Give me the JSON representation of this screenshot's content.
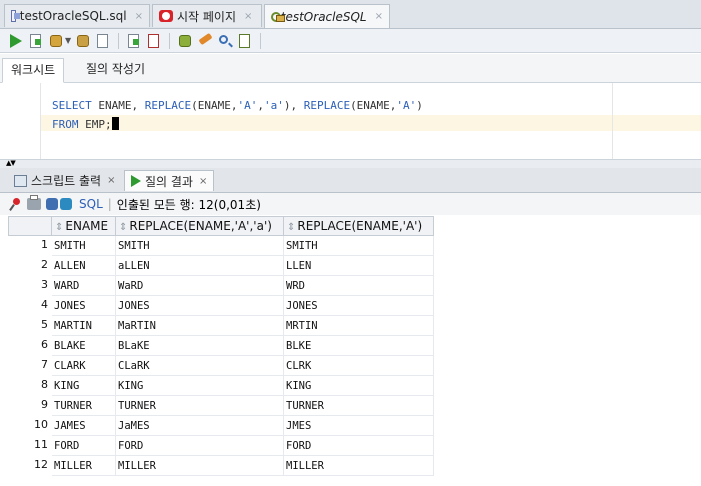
{
  "doc_tabs": [
    {
      "label": "testOracleSQL.sql",
      "icon": "sql-file-icon",
      "close": "×"
    },
    {
      "label": "시작 페이지",
      "icon": "start-page-icon",
      "close": "×"
    },
    {
      "label": "testOracleSQL",
      "icon": "db-connection-icon",
      "close": "×"
    }
  ],
  "subtabs": {
    "worksheet": "워크시트",
    "query_builder": "질의 작성기"
  },
  "editor": {
    "line1": [
      {
        "t": "SELECT",
        "c": "kw"
      },
      {
        "t": " ENAME, ",
        "c": "plain"
      },
      {
        "t": "REPLACE",
        "c": "kw"
      },
      {
        "t": "(ENAME,",
        "c": "plain"
      },
      {
        "t": "'A'",
        "c": "str"
      },
      {
        "t": ",",
        "c": "plain"
      },
      {
        "t": "'a'",
        "c": "str"
      },
      {
        "t": "), ",
        "c": "plain"
      },
      {
        "t": "REPLACE",
        "c": "kw"
      },
      {
        "t": "(ENAME,",
        "c": "plain"
      },
      {
        "t": "'A'",
        "c": "str"
      },
      {
        "t": ")",
        "c": "plain"
      }
    ],
    "line2": [
      {
        "t": "FROM",
        "c": "kw"
      },
      {
        "t": " EMP;",
        "c": "plain"
      }
    ]
  },
  "output_tabs": [
    {
      "label": "스크립트 출력",
      "close": "×"
    },
    {
      "label": "질의 결과",
      "close": "×"
    }
  ],
  "results_toolbar": {
    "sql_label": "SQL",
    "separator": "|",
    "status": "인출된 모든 행: 12(0,01초)"
  },
  "grid": {
    "columns": [
      "ENAME",
      "REPLACE(ENAME,'A','a')",
      "REPLACE(ENAME,'A')"
    ],
    "rows": [
      {
        "n": "1",
        "cells": [
          "SMITH",
          "SMITH",
          "SMITH"
        ]
      },
      {
        "n": "2",
        "cells": [
          "ALLEN",
          "aLLEN",
          "LLEN"
        ]
      },
      {
        "n": "3",
        "cells": [
          "WARD",
          "WaRD",
          "WRD"
        ]
      },
      {
        "n": "4",
        "cells": [
          "JONES",
          "JONES",
          "JONES"
        ]
      },
      {
        "n": "5",
        "cells": [
          "MARTIN",
          "MaRTIN",
          "MRTIN"
        ]
      },
      {
        "n": "6",
        "cells": [
          "BLAKE",
          "BLaKE",
          "BLKE"
        ]
      },
      {
        "n": "7",
        "cells": [
          "CLARK",
          "CLaRK",
          "CLRK"
        ]
      },
      {
        "n": "8",
        "cells": [
          "KING",
          "KING",
          "KING"
        ]
      },
      {
        "n": "9",
        "cells": [
          "TURNER",
          "TURNER",
          "TURNER"
        ]
      },
      {
        "n": "10",
        "cells": [
          "JAMES",
          "JaMES",
          "JMES"
        ]
      },
      {
        "n": "11",
        "cells": [
          "FORD",
          "FORD",
          "FORD"
        ]
      },
      {
        "n": "12",
        "cells": [
          "MILLER",
          "MILLER",
          "MILLER"
        ]
      }
    ]
  }
}
